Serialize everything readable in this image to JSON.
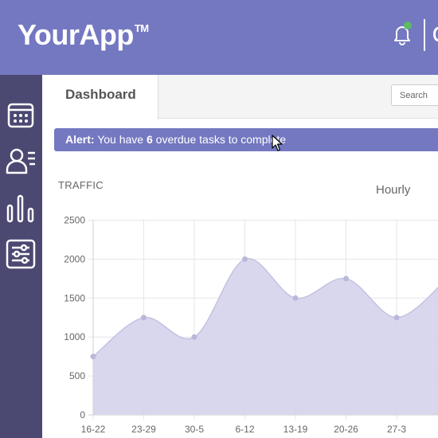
{
  "header": {
    "logo_text": "YourApp",
    "logo_mark": "TM",
    "icons": [
      "bell-icon"
    ],
    "notification_dot_color": "#5dbb63",
    "background_color": "#7478c1"
  },
  "sidebar": {
    "background_color": "#4b4872",
    "items": [
      {
        "icon": "calendar-icon"
      },
      {
        "icon": "contacts-icon"
      },
      {
        "icon": "bar-chart-icon"
      },
      {
        "icon": "settings-sliders-icon"
      }
    ]
  },
  "tabs": {
    "active_label": "Dashboard"
  },
  "search": {
    "placeholder": "Search"
  },
  "alert": {
    "label": "Alert:",
    "text_before": " You have ",
    "count": "6",
    "text_after": " overdue tasks to complete"
  },
  "traffic": {
    "title": "TRAFFIC",
    "mode": "Hourly"
  },
  "chart_data": {
    "type": "area",
    "categories": [
      "16-22",
      "23-29",
      "30-5",
      "6-12",
      "13-19",
      "20-26",
      "27-3",
      ""
    ],
    "values": [
      750,
      1250,
      1000,
      2000,
      1500,
      1750,
      1250,
      1750
    ],
    "ylim": [
      0,
      2500
    ],
    "y_ticks": [
      "0",
      "500",
      "1000",
      "1500",
      "2000",
      "2500"
    ],
    "grid": true,
    "fill_color": "#d6d5ec",
    "line_color": "#c3c2e2",
    "point_color": "#b9b8d9"
  }
}
